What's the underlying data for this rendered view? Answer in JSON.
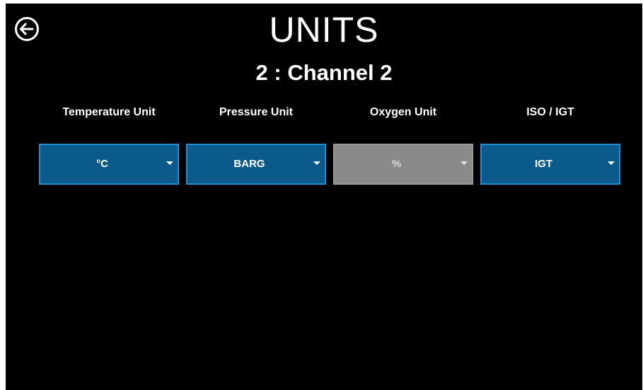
{
  "header": {
    "title": "UNITS",
    "subtitle": "2 : Channel 2",
    "back_icon": "back-arrow-circle-icon"
  },
  "units": [
    {
      "label": "Temperature Unit",
      "value": "°C",
      "enabled": true
    },
    {
      "label": "Pressure Unit",
      "value": "BARG",
      "enabled": true
    },
    {
      "label": "Oxygen Unit",
      "value": "%",
      "enabled": false
    },
    {
      "label": "ISO / IGT",
      "value": "IGT",
      "enabled": true
    }
  ],
  "colors": {
    "background": "#000000",
    "select_enabled": "#0b5a8c",
    "select_border": "#1e8fd0",
    "select_disabled": "#8a8a8a"
  }
}
